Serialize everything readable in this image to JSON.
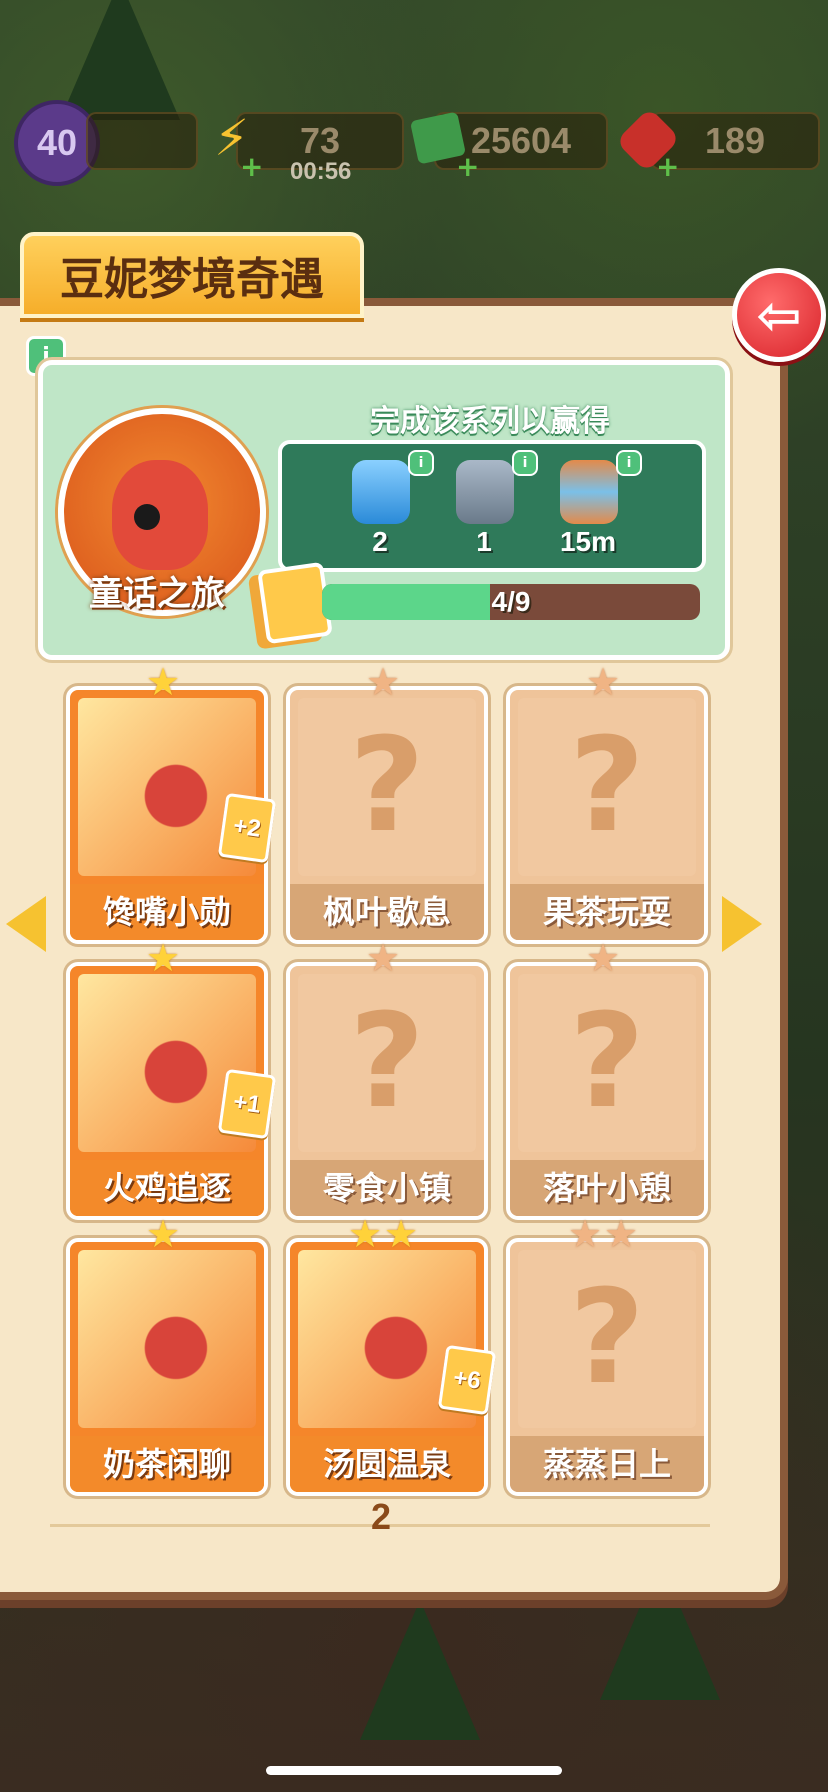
{
  "hud": {
    "level": "40",
    "energy": "73",
    "energy_timer": "00:56",
    "cash": "25604",
    "gems": "189"
  },
  "title": "豆妮梦境奇遇",
  "series": {
    "name": "童话之旅",
    "reward_title": "完成该系列以赢得",
    "rewards": [
      {
        "icon": "energy-jar-icon",
        "value": "2"
      },
      {
        "icon": "cash-safe-icon",
        "value": "1"
      },
      {
        "icon": "hourglass-icon",
        "value": "15m"
      }
    ],
    "progress_text": "4/9",
    "progress_fraction": 0.444
  },
  "cards": [
    {
      "label": "馋嘴小勋",
      "unlocked": true,
      "badge": "+2",
      "stars": 1
    },
    {
      "label": "枫叶歇息",
      "unlocked": false,
      "stars": 1
    },
    {
      "label": "果茶玩耍",
      "unlocked": false,
      "stars": 1
    },
    {
      "label": "火鸡追逐",
      "unlocked": true,
      "badge": "+1",
      "stars": 1
    },
    {
      "label": "零食小镇",
      "unlocked": false,
      "stars": 1
    },
    {
      "label": "落叶小憩",
      "unlocked": false,
      "stars": 1
    },
    {
      "label": "奶茶闲聊",
      "unlocked": true,
      "stars": 1
    },
    {
      "label": "汤圆温泉",
      "unlocked": true,
      "badge": "+6",
      "stars": 2
    },
    {
      "label": "蒸蒸日上",
      "unlocked": false,
      "stars": 2
    }
  ],
  "page_number": "2",
  "colors": {
    "panel": "#f7e7c8",
    "title_tab": "#f6ae2a",
    "reward_panel": "#bfe6c7",
    "progress_fill": "#5cd68a",
    "back_button": "#d8232a"
  }
}
